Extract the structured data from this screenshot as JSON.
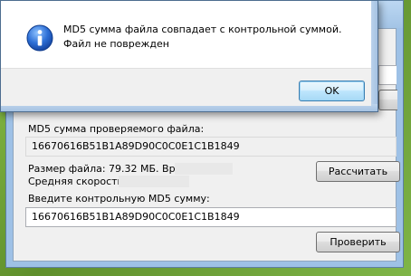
{
  "dialog": {
    "message": "MD5 сумма файла совпадает с контрольной суммой. Файл не поврежден",
    "ok_label": "OK",
    "icon": "info-icon"
  },
  "app": {
    "checked_hash_label": "MD5 сумма проверяемого файла:",
    "checked_hash_value": "16670616B51B1A89D90C0C0E1C1B1849",
    "file_size_label": "Размер файла: 79.32 МБ. Время:",
    "avg_speed_label": "Средняя скорость:",
    "calculate_button": "Рассчитать",
    "enter_checksum_label": "Введите контрольную MD5 сумму:",
    "entered_checksum_value": "16670616B51B1A89D90C0C0E1C1B1849",
    "verify_button": "Проверить"
  },
  "colors": {
    "ok_button_border": "#3c7fb1",
    "dialog_body": "#ffffff",
    "window_frame": "#9ec1e6"
  }
}
